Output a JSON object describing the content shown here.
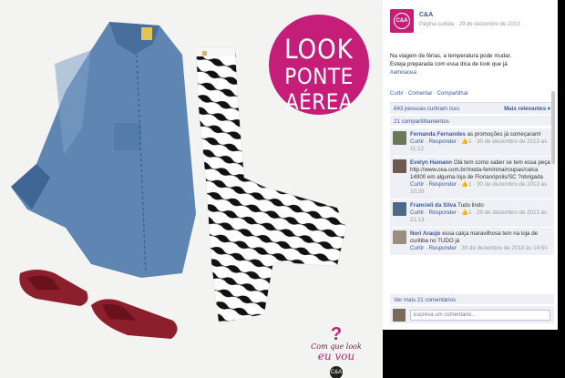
{
  "photo": {
    "badge_line1": "LOOK",
    "badge_line2": "PONTE AÉREA",
    "brand_q": "?",
    "brand_script1": "Com que look",
    "brand_script2": "eu vou",
    "brand_logo": "C&A"
  },
  "post": {
    "page_avatar": "C&A",
    "page_name": "C&A",
    "page_meta": "Página curtida · 29 de dezembro de 2013",
    "text_line1": "Na viagem de férias, a temperatura pode mudar.",
    "text_line2": "Esteja preparada com essa dica de look que já",
    "hashtag": "#amoacea",
    "actions": "Curtir · Comentar · Compartilhar",
    "likes": "843 pessoas curtiram isso.",
    "most_relevant": "Mais relevantes ▾",
    "shares": "21 compartilhamentos"
  },
  "comments": [
    {
      "name": "Fernanda Fernandes",
      "text": "as promoções já começaram!",
      "meta_reply": "Curtir · Responder",
      "meta_likes": "1",
      "meta_date": "30 de dezembro de 2013 às 11:12",
      "avatar_color": "#6b7a55"
    },
    {
      "name": "Evelyn Hamann",
      "text": "Olá tem como saber se tem essa peça http://www.cea.com.br/moda-feminina/roupas/calca 14900 em alguma loja de Florianópolis/SC ?obrigada",
      "meta_reply": "Curtir · Responder",
      "meta_likes": "1",
      "meta_date": "30 de dezembro de 2013 às 10:29",
      "avatar_color": "#6f5a4f"
    },
    {
      "name": "Francieli da Silva",
      "text": "Tudo lindo",
      "meta_reply": "Curtir · Responder",
      "meta_likes": "1",
      "meta_date": "29 de dezembro de 2013 às 21:13",
      "avatar_color": "#4d6a8a"
    },
    {
      "name": "Nori Araujo",
      "text": "essa calça maravilhosa tem na loja de curitiba no TUDO já",
      "meta_reply": "Curtir · Responder",
      "meta_likes": "",
      "meta_date": "30 de dezembro de 2013 às 14:50",
      "avatar_color": "#9a8f7c"
    }
  ],
  "more_comments": "Ver mais 21 comentários",
  "write": {
    "placeholder": "Escreva um comentário..."
  },
  "colors": {
    "brand": "#c41e78",
    "link": "#3b5998",
    "panel": "#eef0f5"
  }
}
